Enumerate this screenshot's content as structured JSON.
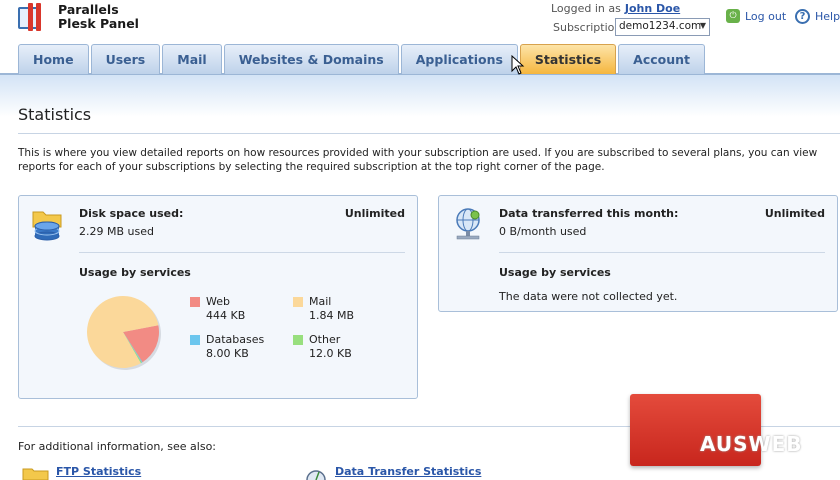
{
  "app": {
    "brand_line1": "Parallels",
    "brand_line2": "Plesk Panel"
  },
  "header": {
    "logged_in_label": "Logged in as",
    "user_name": "John Doe",
    "subscription_label": "Subscription",
    "subscription_value": "demo1234.com",
    "logout_label": "Log out",
    "help_label": "Help"
  },
  "tabs": [
    {
      "label": "Home",
      "active": false
    },
    {
      "label": "Users",
      "active": false
    },
    {
      "label": "Mail",
      "active": false
    },
    {
      "label": "Websites & Domains",
      "active": false
    },
    {
      "label": "Applications",
      "active": false
    },
    {
      "label": "Statistics",
      "active": true
    },
    {
      "label": "Account",
      "active": false
    }
  ],
  "page": {
    "title": "Statistics",
    "description": "This is where you view detailed reports on how resources provided with your subscription are used. If you are subscribed to several plans, you can view reports for each of your subscriptions by selecting the required subscription at the top right corner of the page."
  },
  "disk_panel": {
    "label": "Disk space used:",
    "limit": "Unlimited",
    "used": "2.29 MB used",
    "usage_heading": "Usage by services",
    "legend": [
      {
        "name": "Web",
        "value": "444 KB",
        "color": "#f28b84"
      },
      {
        "name": "Mail",
        "value": "1.84 MB",
        "color": "#fbd89a"
      },
      {
        "name": "Databases",
        "value": "8.00 KB",
        "color": "#6cc6ee"
      },
      {
        "name": "Other",
        "value": "12.0 KB",
        "color": "#98df7e"
      }
    ]
  },
  "traffic_panel": {
    "label": "Data transferred this month:",
    "limit": "Unlimited",
    "used": "0 B/month used",
    "usage_heading": "Usage by services",
    "note": "The data were not collected yet."
  },
  "see_also": {
    "label": "For additional information, see also:",
    "links": [
      "FTP Statistics",
      "Data Transfer Statistics"
    ]
  },
  "watermark": {
    "text": "AUSWEB"
  },
  "chart_data": {
    "type": "pie",
    "categories": [
      "Web",
      "Mail",
      "Databases",
      "Other"
    ],
    "values": [
      444,
      1884,
      8,
      12
    ],
    "unit": "KB",
    "colors": [
      "#f28b84",
      "#fbd89a",
      "#6cc6ee",
      "#98df7e"
    ]
  }
}
